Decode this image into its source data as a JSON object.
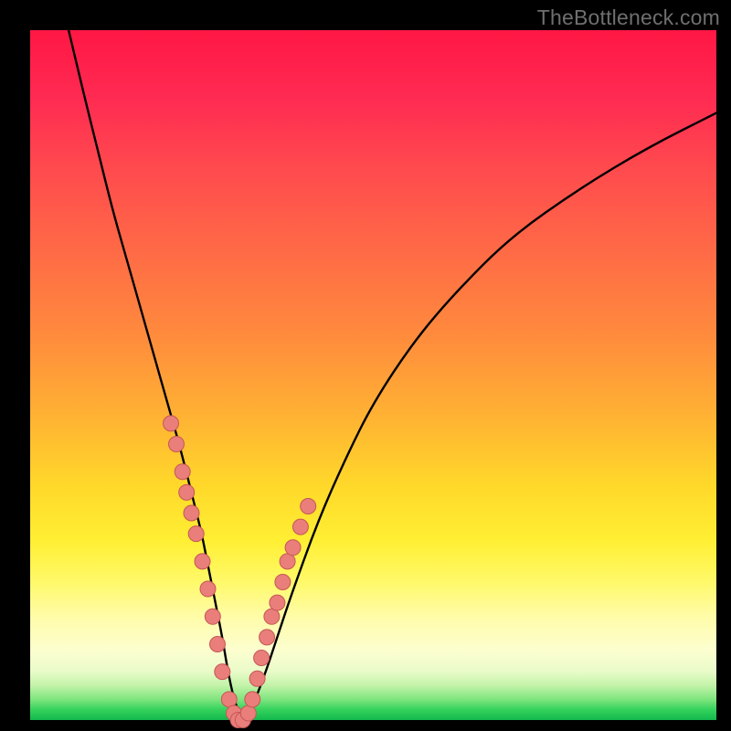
{
  "watermark": "TheBottleneck.com",
  "colors": {
    "bg": "#000000",
    "curve": "#000000",
    "dot": "#e97e7b",
    "dot_stroke": "#c55855"
  },
  "chart_data": {
    "type": "line",
    "title": "",
    "xlabel": "",
    "ylabel": "",
    "xlim": [
      0,
      100
    ],
    "ylim": [
      0,
      100
    ],
    "series": [
      {
        "name": "bottleneck-curve",
        "x": [
          5.6,
          8,
          10,
          12,
          14,
          16,
          18,
          20,
          22,
          24,
          25,
          26,
          27,
          28,
          29,
          30,
          31,
          32,
          34,
          36,
          38,
          42,
          46,
          50,
          56,
          62,
          70,
          80,
          90,
          100
        ],
        "y": [
          100,
          90,
          82,
          74,
          67,
          60,
          53,
          46,
          39,
          31,
          27,
          22,
          17,
          12,
          6,
          2,
          0,
          1,
          6,
          12,
          18,
          29,
          38,
          46,
          55,
          62,
          70,
          77,
          83,
          88
        ]
      }
    ],
    "scatter_points": {
      "name": "highlighted-dots",
      "x": [
        20.5,
        21.3,
        22.2,
        22.8,
        23.5,
        24.2,
        25.1,
        25.9,
        26.6,
        27.3,
        28.0,
        29.0,
        29.7,
        30.3,
        31.0,
        31.8,
        32.4,
        33.1,
        33.7,
        34.5,
        35.2,
        36.0,
        36.8,
        37.5,
        38.3,
        39.4,
        40.5
      ],
      "y": [
        43,
        40,
        36,
        33,
        30,
        27,
        23,
        19,
        15,
        11,
        7,
        3,
        1,
        0,
        0,
        1,
        3,
        6,
        9,
        12,
        15,
        17,
        20,
        23,
        25,
        28,
        31
      ]
    }
  }
}
